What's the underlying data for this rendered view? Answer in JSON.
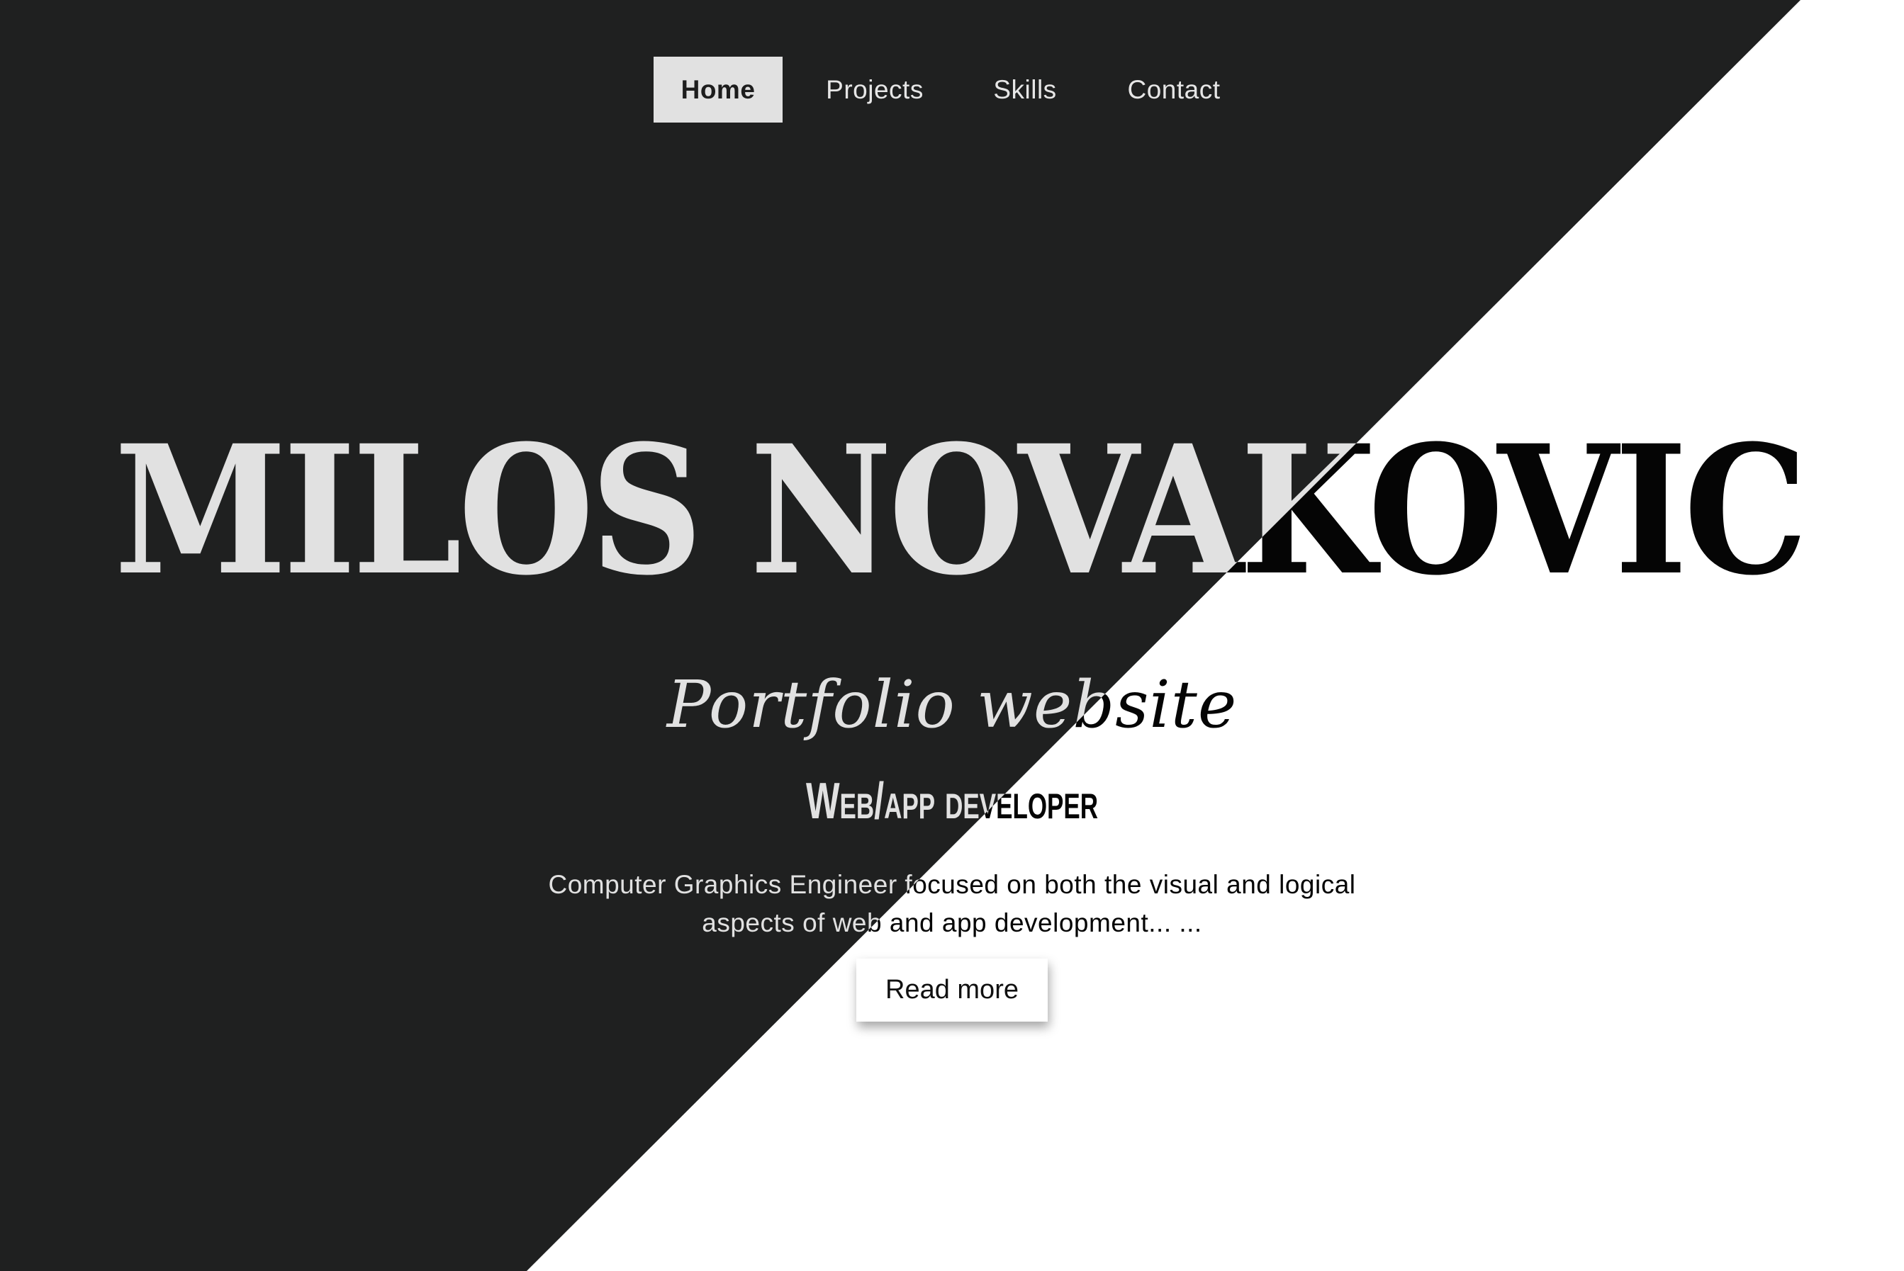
{
  "nav": {
    "items": [
      {
        "label": "Home",
        "active": true
      },
      {
        "label": "Projects",
        "active": false
      },
      {
        "label": "Skills",
        "active": false
      },
      {
        "label": "Contact",
        "active": false
      }
    ]
  },
  "hero": {
    "name": "MILOS NOVAKOVIC",
    "subtitle": "Portfolio website",
    "role": "Web/app developer",
    "description": "Computer Graphics Engineer focused on both the visual and logical aspects of web and app development... ...",
    "button_label": "Read more"
  },
  "colors": {
    "dark_background": "#1f2020",
    "light_background": "#ffffff",
    "light_text": "#e1e1e1",
    "dark_text": "#050505"
  }
}
